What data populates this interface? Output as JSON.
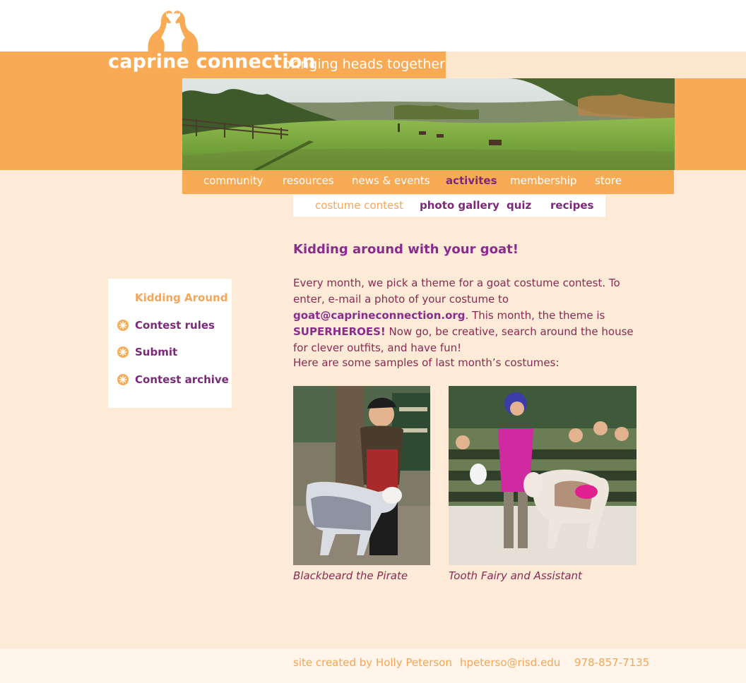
{
  "site": {
    "title": "caprine connection",
    "tagline": "bringing heads together"
  },
  "nav": {
    "items": [
      {
        "label": "community"
      },
      {
        "label": "resources"
      },
      {
        "label": "news & events"
      },
      {
        "label": "activites"
      },
      {
        "label": "membership"
      },
      {
        "label": "store"
      }
    ],
    "active_index": 3
  },
  "subnav": {
    "items": [
      {
        "label": "costume contest"
      },
      {
        "label": "photo gallery"
      },
      {
        "label": "quiz"
      },
      {
        "label": "recipes"
      }
    ],
    "active_index": 0
  },
  "sidebar": {
    "heading": "Kidding Around",
    "items": [
      {
        "label": "Contest rules"
      },
      {
        "label": "Submit"
      },
      {
        "label": "Contest archive"
      }
    ]
  },
  "main": {
    "headline": "Kidding around with your goat!",
    "intro_part1": "Every month, we pick a theme for a goat costume contest. To enter, e-mail a photo of your costume to ",
    "email_link": "goat@caprineconnection.org",
    "intro_part2": ". This month, the theme is ",
    "theme": "SUPERHEROES!",
    "intro_part3": " Now go, be creative, search around the house for clever outfits, and have fun!",
    "samples_text": "Here are some samples of last month’s costumes:",
    "photos": [
      {
        "caption": "Blackbeard the Pirate"
      },
      {
        "caption": "Tooth Fairy and Assistant"
      }
    ]
  },
  "footer": {
    "credit": "site created by Holly Peterson",
    "email": "hpeterso@risd.edu",
    "phone": "978-857-7135"
  },
  "colors": {
    "orange": "#f9aa55",
    "peach_bg": "#fdebd7",
    "purple": "#7a2a78",
    "text_maroon": "#8a2a52"
  }
}
